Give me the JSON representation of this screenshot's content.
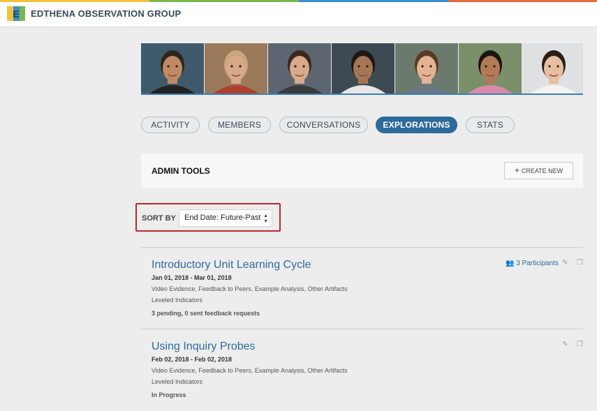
{
  "app": {
    "brand_name": "EDTHENA OBSERVATION GROUP",
    "accent_colors": [
      "#f2c43d",
      "#7bb84a",
      "#3a8fd1",
      "#e26a3f"
    ]
  },
  "member_photos": [
    {
      "name": "member-photo-1",
      "skin": "#c08a64",
      "hair": "#2c2520",
      "bg": "#3f5a6a",
      "shirt": "#222222"
    },
    {
      "name": "member-photo-2",
      "skin": "#d8a88a",
      "hair": "#c9a87c",
      "bg": "#9a7a5a",
      "shirt": "#b0402e"
    },
    {
      "name": "member-photo-3",
      "skin": "#d9a98a",
      "hair": "#3a2820",
      "bg": "#5d6670",
      "shirt": "#3a3a3a"
    },
    {
      "name": "member-photo-4",
      "skin": "#a87554",
      "hair": "#1c1815",
      "bg": "#3d4a52",
      "shirt": "#e6e6e6"
    },
    {
      "name": "member-photo-5",
      "skin": "#e3b394",
      "hair": "#5a3a24",
      "bg": "#6b7a6c",
      "shirt": "#6a7885"
    },
    {
      "name": "member-photo-6",
      "skin": "#b37a57",
      "hair": "#1a1512",
      "bg": "#7a8f6a",
      "shirt": "#d88aa8"
    },
    {
      "name": "member-photo-7",
      "skin": "#e6bea0",
      "hair": "#2a1e18",
      "bg": "#dfe0e2",
      "shirt": "#f4f4f4"
    }
  ],
  "tabs": [
    {
      "label": "ACTIVITY",
      "active": false
    },
    {
      "label": "MEMBERS",
      "active": false
    },
    {
      "label": "CONVERSATIONS",
      "active": false
    },
    {
      "label": "EXPLORATIONS",
      "active": true
    },
    {
      "label": "STATS",
      "active": false
    }
  ],
  "admin": {
    "title": "ADMIN TOOLS",
    "create_label": "CREATE NEW",
    "create_icon": "plus-icon"
  },
  "sort": {
    "label": "SORT BY",
    "selected": "End Date: Future-Past",
    "highlight_color": "#c0262b"
  },
  "explorations": [
    {
      "title": "Introductory Unit Learning Cycle",
      "dates": "Jan 01, 2018 - Mar 01, 2018",
      "features": "Video Evidence, Feedback to Peers, Example Analysis, Other Artifacts",
      "indicators": "Leveled Indicators",
      "status": "3 pending, 0 sent feedback requests",
      "participants": "3 Participants"
    },
    {
      "title": "Using Inquiry Probes",
      "dates": "Feb 02, 2018 - Feb 02, 2018",
      "features": "Video Evidence, Feedback to Peers, Example Analysis, Other Artifacts",
      "indicators": "Leveled Indicators",
      "status": "In Progress",
      "participants": ""
    }
  ],
  "icons": {
    "participants": "people-icon",
    "edit": "pencil-icon",
    "copy": "copy-icon"
  }
}
